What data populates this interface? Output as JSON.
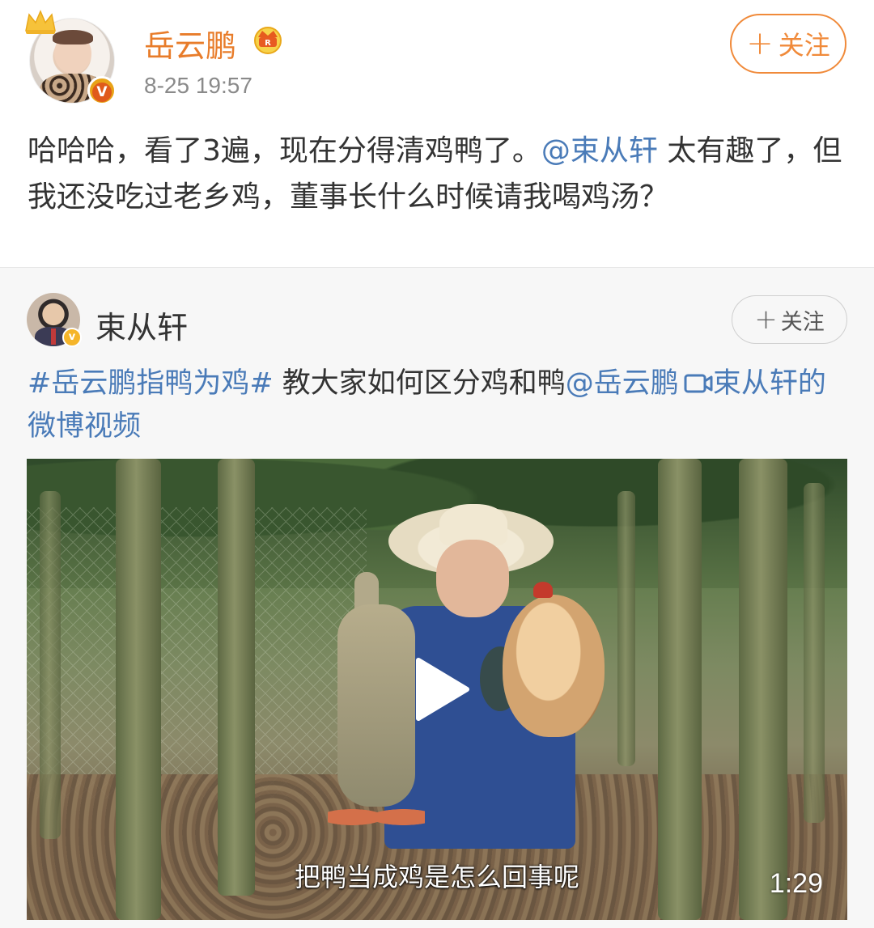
{
  "post": {
    "username": "岳云鹏",
    "time": "8-25 19:57",
    "follow_label": "关注",
    "text_before_mention": "哈哈哈，看了3遍，现在分得清鸡鸭了。",
    "mention": "@束从轩",
    "text_after_mention": " 太有趣了，但我还没吃过老乡鸡，董事长什么时候请我喝鸡汤？"
  },
  "repost": {
    "username": "束从轩",
    "follow_label": "关注",
    "hashtag": "#岳云鹏指鸭为鸡#",
    "text": " 教大家如何区分鸡和鸭",
    "mention": "@岳云鹏",
    "video_link_label": "束从轩的微博视频",
    "video": {
      "subtitle": "把鸭当成鸡是怎么回事呢",
      "duration": "1:29"
    }
  },
  "colors": {
    "username_orange": "#e87c2a",
    "follow_orange": "#f08a3a",
    "link_blue": "#4a7bb8",
    "text": "#333333",
    "repost_bg": "#f7f7f7"
  },
  "icons": [
    "crown-icon",
    "vip-badge-icon",
    "member-crown-icon",
    "verified-icon",
    "video-link-icon",
    "play-icon"
  ]
}
